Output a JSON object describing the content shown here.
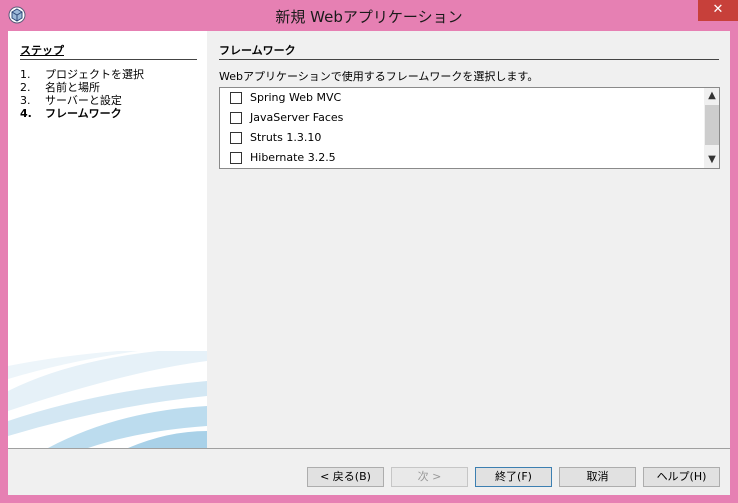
{
  "window": {
    "title": "新規 Webアプリケーション",
    "close_glyph": "✕"
  },
  "steps": {
    "title": "ステップ",
    "items": [
      {
        "num": "1.",
        "label": "プロジェクトを選択"
      },
      {
        "num": "2.",
        "label": "名前と場所"
      },
      {
        "num": "3.",
        "label": "サーバーと設定"
      },
      {
        "num": "4.",
        "label": "フレームワーク"
      }
    ],
    "current_index": 3
  },
  "panel": {
    "title": "フレームワーク",
    "description": "Webアプリケーションで使用するフレームワークを選択します。",
    "frameworks": [
      {
        "label": "Spring Web MVC",
        "checked": false
      },
      {
        "label": "JavaServer Faces",
        "checked": false
      },
      {
        "label": "Struts 1.3.10",
        "checked": false
      },
      {
        "label": "Hibernate 3.2.5",
        "checked": false
      }
    ]
  },
  "buttons": {
    "back": "< 戻る(B)",
    "next": "次 >",
    "finish": "終了(F)",
    "cancel": "取消",
    "help": "ヘルプ(H)"
  },
  "colors": {
    "frame": "#e680b3",
    "close": "#c7403a",
    "client_bg": "#f0f0f0"
  }
}
